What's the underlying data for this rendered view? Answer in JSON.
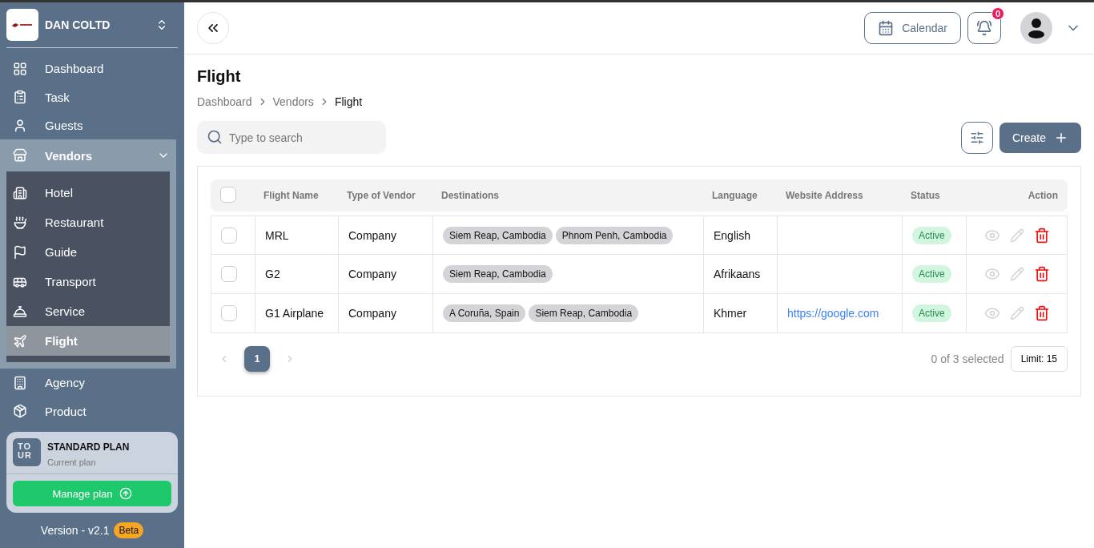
{
  "sidebar": {
    "company": "DAN COLTD",
    "items": [
      {
        "label": "Dashboard",
        "selected": false
      },
      {
        "label": "Task",
        "selected": false
      },
      {
        "label": "Guests",
        "selected": false
      },
      {
        "label": "Vendors",
        "selected": false,
        "expanded": true,
        "children": [
          {
            "label": "Hotel",
            "selected": false
          },
          {
            "label": "Restaurant",
            "selected": false
          },
          {
            "label": "Guide",
            "selected": false
          },
          {
            "label": "Transport",
            "selected": false
          },
          {
            "label": "Service",
            "selected": false
          },
          {
            "label": "Flight",
            "selected": true
          }
        ]
      },
      {
        "label": "Agency",
        "selected": false
      },
      {
        "label": "Product",
        "selected": false
      }
    ],
    "plan": {
      "logo": "TOUR",
      "name": "STANDARD PLAN",
      "subtitle": "Current plan",
      "button": "Manage plan"
    },
    "version": "Version - v2.1",
    "badge": "Beta"
  },
  "topbar": {
    "calendar": "Calendar",
    "notifications": "0"
  },
  "page": {
    "title": "Flight",
    "breadcrumb": [
      "Dashboard",
      "Vendors",
      "Flight"
    ],
    "search": {
      "placeholder": "Type to search"
    },
    "create": "Create"
  },
  "table": {
    "columns": [
      "Flight Name",
      "Type of Vendor",
      "Destinations",
      "Language",
      "Website Address",
      "Status",
      "Action"
    ],
    "header_checked": false,
    "rows": [
      {
        "checked": false,
        "name": "MRL",
        "type": "Company",
        "destinations": [
          "Siem Reap, Cambodia",
          "Phnom Penh, Cambodia"
        ],
        "language": "English",
        "website": "",
        "status": "Active"
      },
      {
        "checked": false,
        "name": "G2",
        "type": "Company",
        "destinations": [
          "Siem Reap, Cambodia"
        ],
        "language": "Afrikaans",
        "website": "",
        "status": "Active"
      },
      {
        "checked": false,
        "name": "G1 Airplane",
        "type": "Company",
        "destinations": [
          "A Coruña, Spain",
          "Siem Reap, Cambodia"
        ],
        "language": "Khmer",
        "website": "https://google.com",
        "status": "Active"
      }
    ]
  },
  "pagination": {
    "pages": [
      {
        "label": "1",
        "selected": true
      }
    ],
    "summary": "0 of 3 selected",
    "limit": "Limit: 15"
  }
}
